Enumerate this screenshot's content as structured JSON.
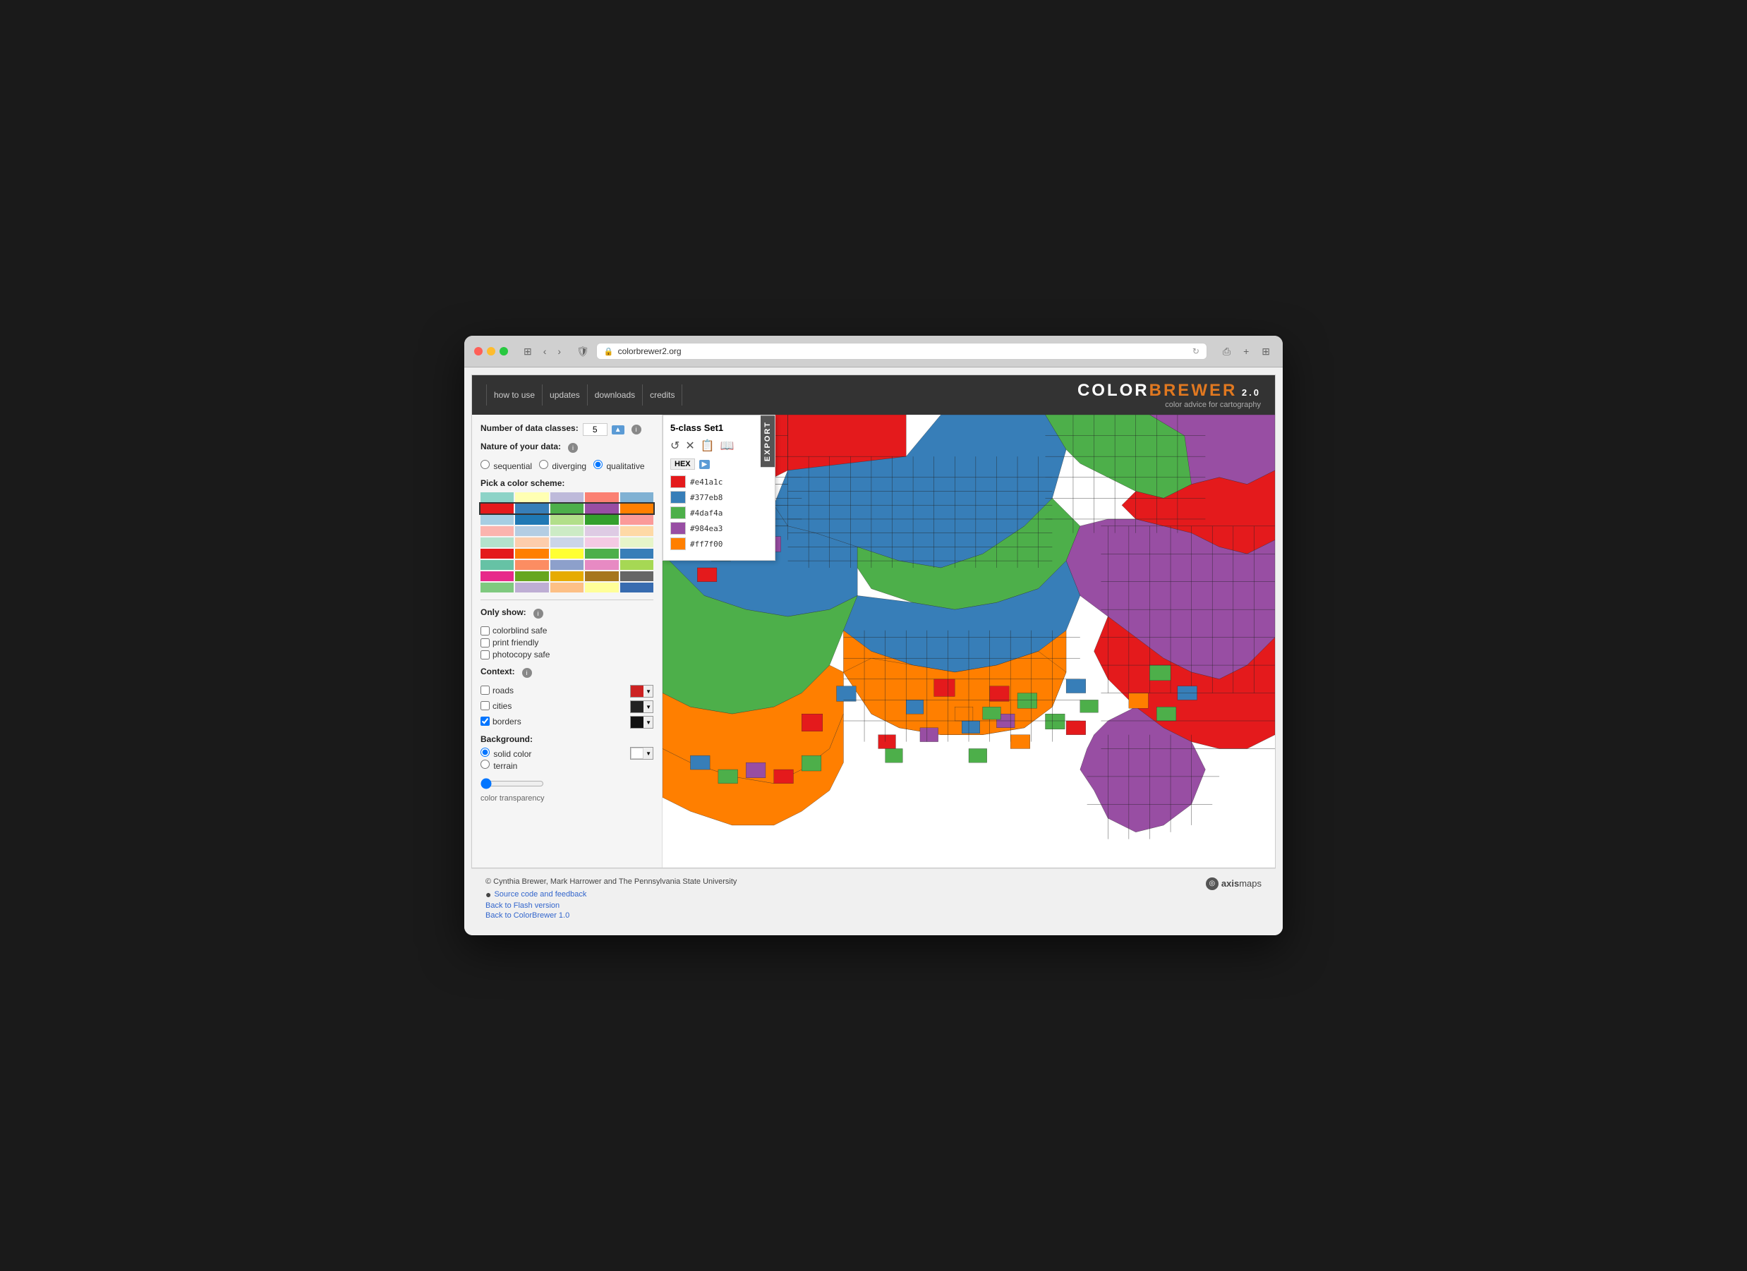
{
  "browser": {
    "url": "colorbrewer2.org",
    "back_label": "‹",
    "forward_label": "›",
    "reload_label": "↻",
    "share_label": "⎙",
    "new_tab_label": "+",
    "grid_label": "⊞"
  },
  "app": {
    "nav": [
      {
        "label": "how to use",
        "id": "nav-how"
      },
      {
        "label": "updates",
        "id": "nav-updates"
      },
      {
        "label": "downloads",
        "id": "nav-downloads"
      },
      {
        "label": "credits",
        "id": "nav-credits"
      }
    ],
    "logo": {
      "color": "COLOR",
      "brewer": "BREWER",
      "version": " 2.0",
      "subtitle": "color advice for cartography"
    }
  },
  "sidebar": {
    "num_classes_label": "Number of data classes:",
    "num_classes_value": "5",
    "nature_label": "Nature of your data:",
    "options": [
      {
        "label": "sequential",
        "value": "sequential"
      },
      {
        "label": "diverging",
        "value": "diverging"
      },
      {
        "label": "qualitative",
        "value": "qualitative",
        "selected": true
      }
    ],
    "pick_scheme_label": "Pick a color scheme:",
    "only_show_label": "Only show:",
    "filters": [
      {
        "label": "colorblind safe",
        "checked": false
      },
      {
        "label": "print friendly",
        "checked": false
      },
      {
        "label": "photocopy safe",
        "checked": false
      }
    ],
    "context_label": "Context:",
    "context_items": [
      {
        "label": "roads",
        "checked": false,
        "color": "#cc2222"
      },
      {
        "label": "cities",
        "checked": false,
        "color": "#222222"
      },
      {
        "label": "borders",
        "checked": true,
        "color": "#111111"
      }
    ],
    "background_label": "Background:",
    "background_options": [
      {
        "label": "solid color",
        "selected": true
      },
      {
        "label": "terrain",
        "selected": false
      }
    ],
    "transparency_label": "color transparency"
  },
  "export_panel": {
    "title": "5-class Set1",
    "format_label": "HEX",
    "export_label": "EXPORT",
    "colors": [
      {
        "hex": "#e41a1c",
        "color": "#e41a1c"
      },
      {
        "hex": "#377eb8",
        "color": "#377eb8"
      },
      {
        "hex": "#4daf4a",
        "color": "#4daf4a"
      },
      {
        "hex": "#984ea3",
        "color": "#984ea3"
      },
      {
        "hex": "#ff7f00",
        "color": "#ff7f00"
      }
    ],
    "icons": [
      "♻",
      "✕",
      "📋",
      "📖"
    ]
  },
  "footer": {
    "copyright": "© Cynthia Brewer, Mark Harrower and The Pennsylvania State University",
    "links": [
      {
        "label": "Source code and feedback",
        "url": "#"
      },
      {
        "label": "Back to Flash version",
        "url": "#"
      },
      {
        "label": "Back to ColorBrewer 1.0",
        "url": "#"
      }
    ],
    "axismaps": "axismaps"
  },
  "palettes": {
    "qualitative": [
      {
        "colors": [
          "#8dd3c7",
          "#ffffb3",
          "#bebada",
          "#fb8072",
          "#80b1d3",
          "#fdb462",
          "#b3de69",
          "#fccde5",
          "#d9d9d9"
        ]
      },
      {
        "colors": [
          "#e41a1c",
          "#377eb8",
          "#4daf4a",
          "#984ea3",
          "#ff7f00",
          "#ffff33",
          "#a65628",
          "#f781bf",
          "#999999"
        ]
      },
      {
        "colors": [
          "#a6cee3",
          "#1f78b4",
          "#b2df8a",
          "#33a02c",
          "#fb9a99",
          "#e31a1c",
          "#fdbf6f",
          "#ff7f00",
          "#cab2d6"
        ]
      },
      {
        "colors": [
          "#fbb4ae",
          "#b3cde3",
          "#ccebc5",
          "#decbe4",
          "#fed9a6",
          "#ffffcc",
          "#e5d8bd",
          "#fddaec",
          "#f2f2f2"
        ]
      },
      {
        "colors": [
          "#b3e2cd",
          "#fdcdac",
          "#cbd5e8",
          "#f4cae4",
          "#e6f5c9",
          "#fff2ae",
          "#f1e2cc",
          "#cccccc",
          "#ffffff"
        ]
      },
      {
        "colors": [
          "#e41a1c",
          "#377eb8",
          "#4daf4a",
          "#984ea3",
          "#ff7f00",
          "#ffff33",
          "#a65628",
          "#f781bf",
          "#999999"
        ]
      },
      {
        "colors": [
          "#66c2a5",
          "#fc8d62",
          "#8da0cb",
          "#e78ac3",
          "#a6d854",
          "#ffd92f",
          "#e5c494",
          "#b3b3b3",
          "#ffffff"
        ]
      },
      {
        "colors": [
          "#e7298a",
          "#66a61e",
          "#e6ab02",
          "#a6761d",
          "#666666",
          "#1b9e77",
          "#d95f02",
          "#7570b3",
          "#ffffff"
        ]
      },
      {
        "colors": [
          "#7fc97f",
          "#beaed4",
          "#fdc086",
          "#ffff99",
          "#386cb0",
          "#f0027f",
          "#bf5b17",
          "#666666",
          "#ffffff"
        ]
      }
    ]
  }
}
